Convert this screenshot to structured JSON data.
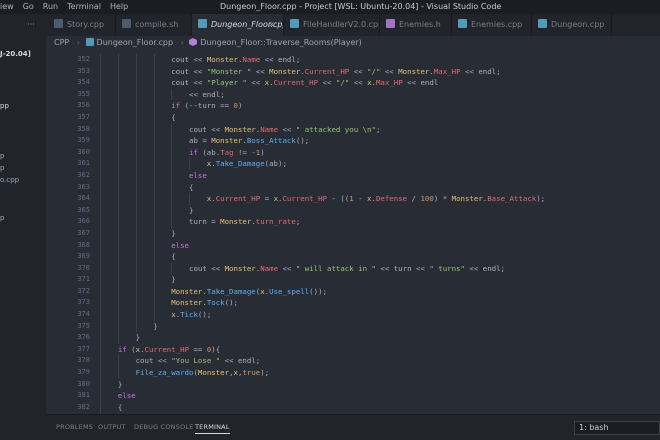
{
  "window": {
    "title": "Dungeon_Floor.cpp - Project [WSL: Ubuntu-20.04] - Visual Studio Code",
    "menu": [
      "iew",
      "Go",
      "Run",
      "Terminal",
      "Help"
    ]
  },
  "tabs": {
    "overflow": "···",
    "items": [
      {
        "label": "Story.cpp",
        "icon_color": "#4e5a6e"
      },
      {
        "label": "compile.sh",
        "icon_color": "#4e5a6e"
      },
      {
        "label": "Dungeon_Floor.cpp",
        "icon_color": "#519aba",
        "close": "×"
      },
      {
        "label": "FileHandlerV2.0.cpp",
        "icon_color": "#519aba"
      },
      {
        "label": "Enemies.h",
        "icon_color": "#a074c4"
      },
      {
        "label": "Enemies.cpp",
        "icon_color": "#519aba"
      },
      {
        "label": "Dungeon.cpp",
        "icon_color": "#519aba"
      }
    ]
  },
  "breadcrumb": {
    "folder": "CPP",
    "file": "Dungeon_Floor.cpp",
    "symbol": "Dungeon_Floor::Traverse_Rooms(Player)"
  },
  "sidebar": {
    "workspace": "J-20.04]",
    "fragments": [
      "pp",
      "p",
      "p",
      "o.cpp",
      "p"
    ]
  },
  "code": {
    "line_numbers": [
      "352",
      "353",
      "354",
      "355",
      "356",
      "357",
      "358",
      "359",
      "360",
      "361",
      "362",
      "363",
      "364",
      "365",
      "366",
      "367",
      "368",
      "369",
      "370",
      "371",
      "372",
      "373",
      "374",
      "375",
      "376",
      "377",
      "378",
      "379",
      "380",
      "381",
      "382",
      "383",
      "384"
    ],
    "colors": {
      "keyword": "#c678dd",
      "class": "#e5c07b",
      "member": "#e06c75",
      "function": "#61afef",
      "string": "#98c379",
      "number": "#d19a66"
    }
  },
  "panel": {
    "tabs": [
      "PROBLEMS",
      "OUTPUT",
      "DEBUG CONSOLE",
      "TERMINAL"
    ],
    "terminal_select": "1: bash"
  }
}
